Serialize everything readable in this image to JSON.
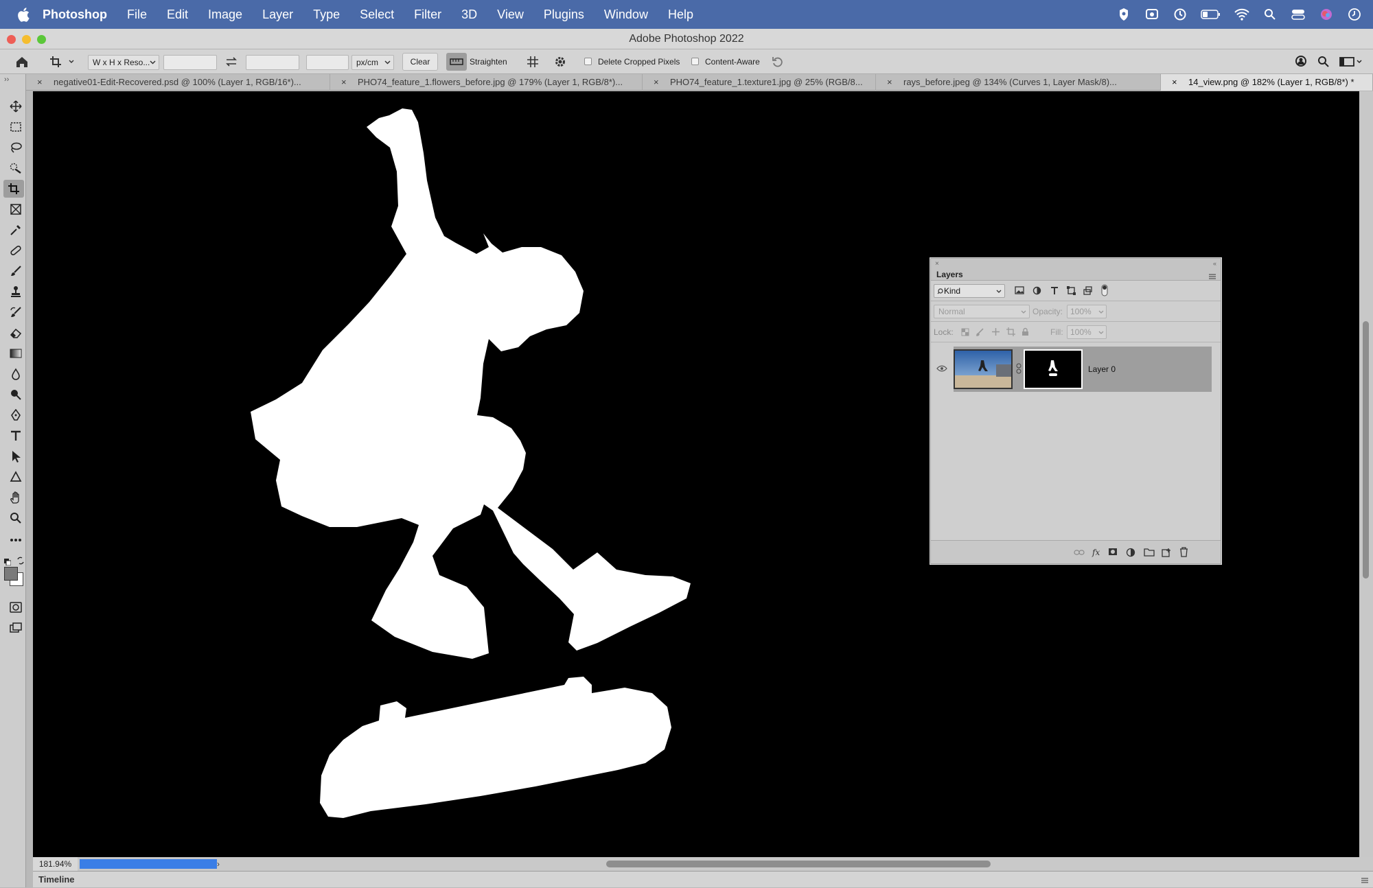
{
  "menubar": {
    "app_name": "Photoshop",
    "items": [
      "File",
      "Edit",
      "Image",
      "Layer",
      "Type",
      "Select",
      "Filter",
      "3D",
      "View",
      "Plugins",
      "Window",
      "Help"
    ],
    "status_icons": [
      "location-shield-icon",
      "screen-mirror-icon",
      "time-machine-icon",
      "battery-icon",
      "wifi-icon",
      "spotlight-search-icon",
      "control-center-icon",
      "siri-icon",
      "clock-icon"
    ]
  },
  "window": {
    "title": "Adobe Photoshop 2022"
  },
  "options": {
    "ratio_select": "W x H x Reso...",
    "width_value": "",
    "height_value": "",
    "resolution_value": "",
    "unit_select": "px/cm",
    "clear_label": "Clear",
    "straighten_label": "Straighten",
    "delete_cropped_label": "Delete Cropped Pixels",
    "delete_cropped_checked": false,
    "content_aware_label": "Content-Aware",
    "content_aware_checked": false
  },
  "tabs": [
    {
      "label": "negative01-Edit-Recovered.psd @ 100% (Layer 1, RGB/16*)...",
      "active": false
    },
    {
      "label": "PHO74_feature_1.flowers_before.jpg @ 179% (Layer 1, RGB/8*)...",
      "active": false
    },
    {
      "label": "PHO74_feature_1.texture1.jpg @ 25% (RGB/8...",
      "active": false
    },
    {
      "label": "rays_before.jpeg @ 134% (Curves 1, Layer Mask/8)...",
      "active": false
    },
    {
      "label": "14_view.png @ 182% (Layer 1, RGB/8*) *",
      "active": true
    }
  ],
  "tools": [
    "move-icon",
    "marquee-icon",
    "lasso-icon",
    "quick-select-icon",
    "crop-icon",
    "frame-icon",
    "eyedropper-icon",
    "healing-icon",
    "brush-icon",
    "stamp-icon",
    "history-brush-icon",
    "eraser-icon",
    "gradient-icon",
    "blur-icon",
    "dodge-icon",
    "pen-icon",
    "type-icon",
    "path-select-icon",
    "shape-icon",
    "hand-icon",
    "zoom-icon",
    "more-icon"
  ],
  "colors": {
    "foreground": "#7a7a7a",
    "background": "#ffffff",
    "accent": "#3a7ee6"
  },
  "layers_panel": {
    "title": "Layers",
    "filter_label": "Kind",
    "blend_mode": "Normal",
    "opacity_label": "Opacity:",
    "opacity_value": "100%",
    "lock_label": "Lock:",
    "fill_label": "Fill:",
    "fill_value": "100%",
    "layers": [
      {
        "name": "Layer 0",
        "visible": true,
        "has_mask": true
      }
    ]
  },
  "status": {
    "zoom": "181.94%",
    "timeline_label": "Timeline"
  }
}
